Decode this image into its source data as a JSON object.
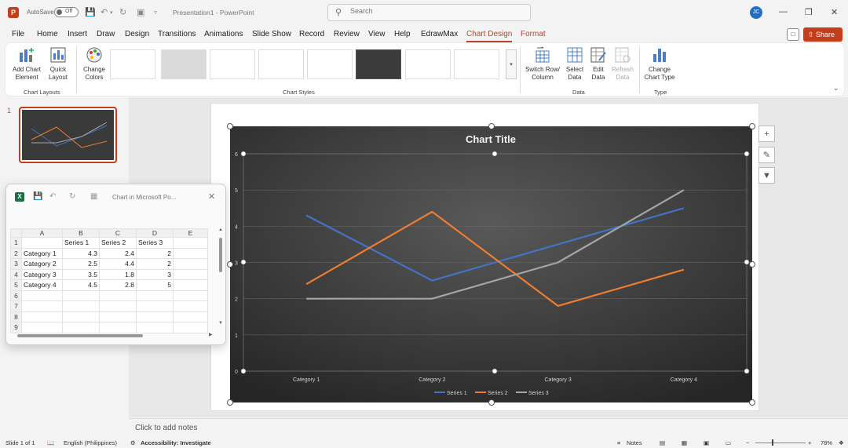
{
  "titlebar": {
    "app_icon": "P",
    "autosave_label": "AutoSave",
    "autosave_state": "Off",
    "doc_title": "Presentation1 - PowerPoint",
    "search_placeholder": "Search",
    "avatar_initials": "JC"
  },
  "menu": {
    "tabs": [
      "File",
      "Home",
      "Insert",
      "Draw",
      "Design",
      "Transitions",
      "Animations",
      "Slide Show",
      "Record",
      "Review",
      "View",
      "Help",
      "EdrawMax",
      "Chart Design",
      "Format"
    ],
    "active_tab": "Chart Design",
    "share_label": "Share"
  },
  "ribbon": {
    "chart_layouts": {
      "add_chart_element": "Add Chart Element",
      "quick_layout": "Quick Layout",
      "label": "Chart Layouts"
    },
    "change_colors": "Change Colors",
    "chart_styles_label": "Chart Styles",
    "data": {
      "switch_row_column": "Switch Row/ Column",
      "select_data": "Select Data",
      "edit_data": "Edit Data",
      "refresh_data": "Refresh Data",
      "label": "Data"
    },
    "type": {
      "change_chart_type": "Change Chart Type",
      "label": "Type"
    }
  },
  "slides_pane": {
    "slide_number": "1"
  },
  "excel": {
    "title": "Chart in Microsoft Po...",
    "col_headers": [
      "A",
      "B",
      "C",
      "D",
      "E"
    ],
    "row_numbers": [
      "1",
      "2",
      "3",
      "4",
      "5",
      "6",
      "7",
      "8",
      "9"
    ],
    "header_row": [
      "",
      "Series 1",
      "Series 2",
      "Series 3",
      ""
    ],
    "rows": [
      [
        "Category 1",
        "4.3",
        "2.4",
        "2",
        ""
      ],
      [
        "Category 2",
        "2.5",
        "4.4",
        "2",
        ""
      ],
      [
        "Category 3",
        "3.5",
        "1.8",
        "3",
        ""
      ],
      [
        "Category 4",
        "4.5",
        "2.8",
        "5",
        ""
      ]
    ]
  },
  "chart_data": {
    "type": "line",
    "title": "Chart Title",
    "categories": [
      "Category 1",
      "Category 2",
      "Category 3",
      "Category 4"
    ],
    "series": [
      {
        "name": "Series 1",
        "values": [
          4.3,
          2.5,
          3.5,
          4.5
        ],
        "color": "#4472c4"
      },
      {
        "name": "Series 2",
        "values": [
          2.4,
          4.4,
          1.8,
          2.8
        ],
        "color": "#ed7d31"
      },
      {
        "name": "Series 3",
        "values": [
          2,
          2,
          3,
          5
        ],
        "color": "#a5a5a5"
      }
    ],
    "ylim": [
      0,
      6
    ],
    "yticks": [
      "0",
      "1",
      "2",
      "3",
      "4",
      "5",
      "6"
    ],
    "grid": true,
    "legend": "bottom",
    "background": "#3d3d3d"
  },
  "notes": {
    "placeholder": "Click to add notes"
  },
  "status": {
    "slide": "Slide 1 of 1",
    "language": "English (Philippines)",
    "accessibility": "Accessibility: Investigate",
    "notes_label": "Notes",
    "zoom": "78%"
  }
}
